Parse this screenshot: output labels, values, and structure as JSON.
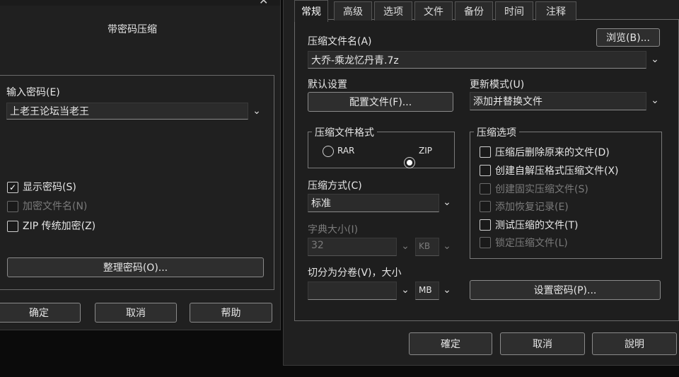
{
  "left_dialog": {
    "title": "带密码压缩",
    "password_label": "输入密码(E)",
    "password_value": "上老王论坛当老王",
    "show_password": "显示密码(S)",
    "encrypt_filenames": "加密文件名(N)",
    "zip_legacy": "ZIP 传统加密(Z)",
    "organize_button": "整理密码(O)...",
    "ok": "确定",
    "cancel": "取消",
    "help": "帮助"
  },
  "right_dialog": {
    "tabs": [
      "常规",
      "高级",
      "选项",
      "文件",
      "备份",
      "时间",
      "注释"
    ],
    "archive_name_label": "压缩文件名(A)",
    "browse": "浏览(B)...",
    "archive_name_value": "大乔-乘龙忆丹青.7z",
    "default_settings_label": "默认设置",
    "profiles_button": "配置文件(F)...",
    "update_mode_label": "更新模式(U)",
    "update_mode_value": "添加并替换文件",
    "format_group": "压缩文件格式",
    "format_rar": "RAR",
    "format_zip": "ZIP",
    "method_label": "压缩方式(C)",
    "method_value": "标准",
    "dict_label": "字典大小(I)",
    "dict_value": "32",
    "dict_unit": "KB",
    "split_label": "切分为分卷(V)，大小",
    "split_value": "",
    "split_unit": "MB",
    "options_group": "压缩选项",
    "opt1": "压缩后删除原来的文件(D)",
    "opt2": "创建自解压格式压缩文件(X)",
    "opt3": "创建固实压缩文件(S)",
    "opt4": "添加恢复记录(E)",
    "opt5": "测试压缩的文件(T)",
    "opt6": "锁定压缩文件(L)",
    "set_password": "设置密码(P)...",
    "ok": "確定",
    "cancel": "取消",
    "help": "說明"
  }
}
